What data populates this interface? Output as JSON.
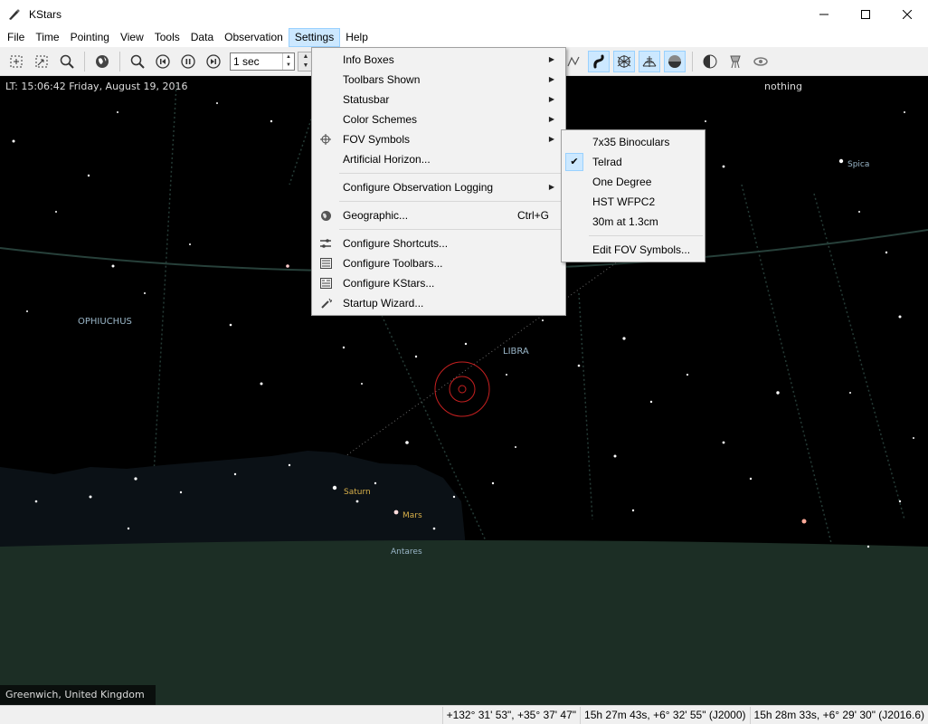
{
  "window": {
    "title": "KStars"
  },
  "menubar": [
    "File",
    "Time",
    "Pointing",
    "View",
    "Tools",
    "Data",
    "Observation",
    "Settings",
    "Help"
  ],
  "toolbar": {
    "time_step": "1 sec"
  },
  "sky": {
    "time": "LT: 15:06:42   Friday, August 19, 2016",
    "focus": "nothing",
    "constellations": [
      "OPHIUCHUS",
      "LIBRA"
    ],
    "stars": [
      "Spica",
      "Antares"
    ],
    "planets": [
      "Saturn",
      "Mars"
    ],
    "location": "Greenwich, United Kingdom"
  },
  "colors": {
    "planet_label": "#d8b04a",
    "star_label": "#9ab6c8",
    "ground": "#1c2e25",
    "horizon_mask": "#0b1116"
  },
  "settings_menu": {
    "items": [
      {
        "label": "Info Boxes",
        "submenu": true
      },
      {
        "label": "Toolbars Shown",
        "submenu": true
      },
      {
        "label": "Statusbar",
        "submenu": true
      },
      {
        "label": "Color Schemes",
        "submenu": true
      },
      {
        "label": "FOV Symbols",
        "submenu": true,
        "icon": "crosshair-icon"
      },
      {
        "label": "Artificial Horizon..."
      },
      {
        "label": "Configure Observation Logging",
        "submenu": true
      },
      {
        "label": "Geographic...",
        "shortcut": "Ctrl+G",
        "icon": "globe-icon"
      },
      {
        "label": "Configure Shortcuts...",
        "icon": "shortcuts-icon"
      },
      {
        "label": "Configure Toolbars...",
        "icon": "toolbars-icon"
      },
      {
        "label": "Configure KStars...",
        "icon": "configure-icon"
      },
      {
        "label": "Startup Wizard...",
        "icon": "wizard-icon"
      }
    ]
  },
  "fov_menu": {
    "items": [
      "7x35 Binoculars",
      "Telrad",
      "One Degree",
      "HST WFPC2",
      "30m at 1.3cm",
      "Edit FOV Symbols..."
    ],
    "checked": "Telrad"
  },
  "status": {
    "altaz": "+132° 31' 53\", +35° 37' 47\"",
    "j2000": "15h 27m 43s, +6° 32' 55\" (J2000)",
    "jnow": "15h 28m 33s, +6° 29' 30\" (J2016.6)"
  }
}
